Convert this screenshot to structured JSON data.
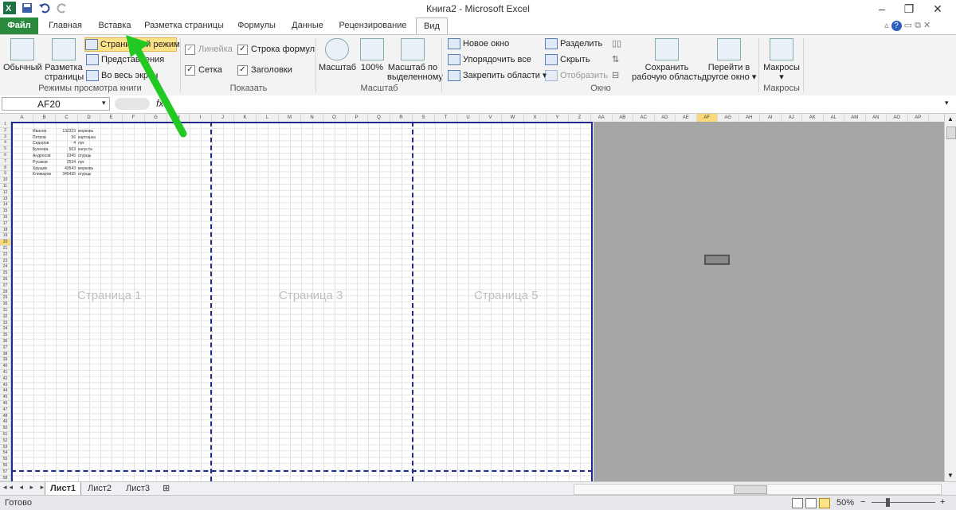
{
  "window": {
    "title": "Книга2 - Microsoft Excel"
  },
  "tabs": [
    "Файл",
    "Главная",
    "Вставка",
    "Разметка страницы",
    "Формулы",
    "Данные",
    "Рецензирование",
    "Вид"
  ],
  "ribbon": {
    "views": {
      "normal": "Обычный",
      "page_layout_1": "Разметка",
      "page_layout_2": "страницы",
      "page_break": "Страничный режим",
      "custom": "Представления",
      "fullscreen": "Во весь экран",
      "group_label": "Режимы просмотра книги"
    },
    "show": {
      "ruler": "Линейка",
      "formula_bar": "Строка формул",
      "gridlines": "Сетка",
      "headings": "Заголовки",
      "group_label": "Показать"
    },
    "zoom": {
      "zoom": "Масштаб",
      "hundred": "100%",
      "zoom_sel_1": "Масштаб по",
      "zoom_sel_2": "выделенному",
      "group_label": "Масштаб"
    },
    "window": {
      "new_window": "Новое окно",
      "arrange": "Упорядочить все",
      "freeze": "Закрепить области",
      "split": "Разделить",
      "hide": "Скрыть",
      "unhide": "Отобразить",
      "save_ws_1": "Сохранить",
      "save_ws_2": "рабочую область",
      "switch_1": "Перейти в",
      "switch_2": "другое окно",
      "group_label": "Окно"
    },
    "macros": {
      "label": "Макросы",
      "group_label": "Макросы"
    }
  },
  "formula_bar": {
    "name_box": "AF20",
    "fx": "fx"
  },
  "columns": [
    "A",
    "B",
    "C",
    "D",
    "E",
    "F",
    "G",
    "H",
    "I",
    "J",
    "K",
    "L",
    "M",
    "N",
    "O",
    "P",
    "Q",
    "R",
    "S",
    "T",
    "U",
    "V",
    "W",
    "X",
    "Y",
    "Z",
    "AA",
    "AB",
    "AC",
    "AD",
    "AE",
    "AF",
    "AG",
    "AH",
    "AI",
    "AJ",
    "AK",
    "AL",
    "AM",
    "AN",
    "AO",
    "AP"
  ],
  "cells": [
    {
      "name": "Иванов",
      "value": "132323",
      "unit": "морковь"
    },
    {
      "name": "Петров",
      "value": "56",
      "unit": "картошка"
    },
    {
      "name": "Сидоров",
      "value": "4",
      "unit": "лук"
    },
    {
      "name": "Бунеева",
      "value": "563",
      "unit": "капуста"
    },
    {
      "name": "Андросов",
      "value": "2345",
      "unit": "огурцы"
    },
    {
      "name": "Русаков",
      "value": "2534",
      "unit": "лук"
    },
    {
      "name": "Хрущев",
      "value": "43543",
      "unit": "морковь"
    },
    {
      "name": "Климаров",
      "value": "345435",
      "unit": "огурцы"
    }
  ],
  "watermarks": [
    "Страница 1",
    "Страница 3",
    "Страница 5"
  ],
  "sheets": [
    "Лист1",
    "Лист2",
    "Лист3"
  ],
  "status": {
    "ready": "Готово",
    "zoom": "50%"
  },
  "colors": {
    "file_tab": "#2a8a3e",
    "page_break": "#1e2a8c",
    "arrow": "#22c922",
    "highlight": "#fde388"
  }
}
